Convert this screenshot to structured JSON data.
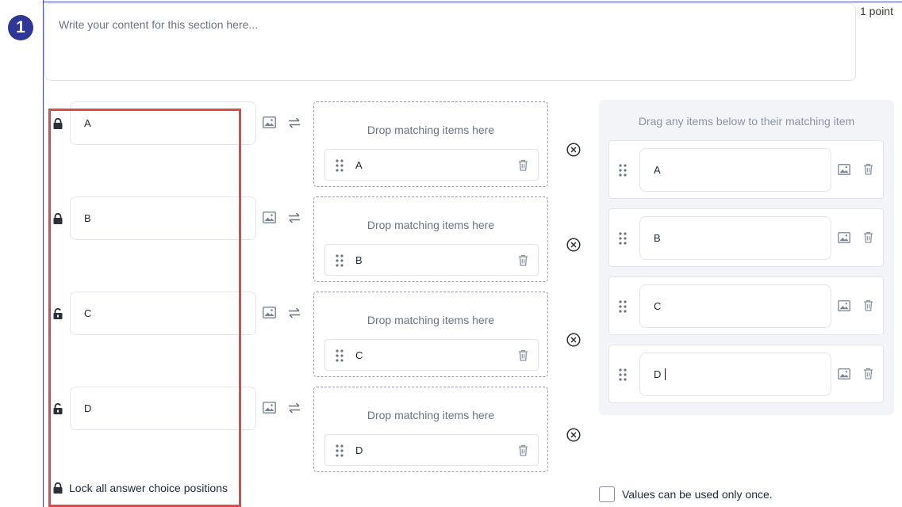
{
  "question": {
    "number": "1",
    "points_label": "1 point",
    "content_placeholder": "Write your content for this section here..."
  },
  "rows": [
    {
      "lock": "locked",
      "choice": "A",
      "drop_label": "Drop matching items here",
      "match": "A"
    },
    {
      "lock": "locked",
      "choice": "B",
      "drop_label": "Drop matching items here",
      "match": "B"
    },
    {
      "lock": "unlocked",
      "choice": "C",
      "drop_label": "Drop matching items here",
      "match": "C"
    },
    {
      "lock": "unlocked",
      "choice": "D",
      "drop_label": "Drop matching items here",
      "match": "D"
    }
  ],
  "bank": {
    "title": "Drag any items below to their matching item",
    "items": [
      {
        "label": "A"
      },
      {
        "label": "B"
      },
      {
        "label": "C"
      },
      {
        "label": "D",
        "focused": true
      }
    ]
  },
  "footer": {
    "lock_all_label": "Lock all answer choice positions",
    "values_once_label": "Values can be used only once.",
    "values_once_checked": false
  },
  "colors": {
    "accent": "#2d3798",
    "highlight_box": "#e04848",
    "bank_bg": "#f3f4f7"
  }
}
